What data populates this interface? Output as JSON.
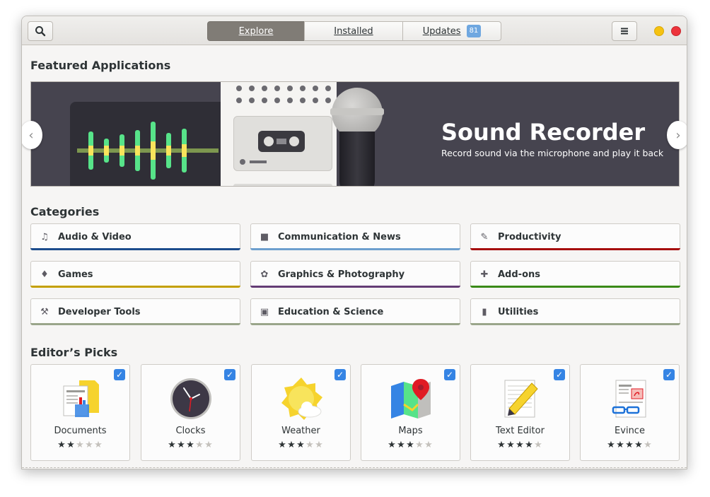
{
  "header": {
    "tabs": [
      {
        "label": "Explore",
        "active": true
      },
      {
        "label": "Installed",
        "active": false
      },
      {
        "label": "Updates",
        "active": false,
        "badge": "81"
      }
    ],
    "icons": {
      "search": "search-icon",
      "menu": "hamburger-menu-icon",
      "minimize": "minimize-icon",
      "close": "close-icon"
    }
  },
  "featured": {
    "section_title": "Featured Applications",
    "app_name": "Sound Recorder",
    "description": "Record sound via the microphone and play it back",
    "prev_arrow": "‹",
    "next_arrow": "›"
  },
  "categories": {
    "section_title": "Categories",
    "items": [
      {
        "label": "Audio & Video",
        "icon": "♫",
        "color": "#1c4c8c"
      },
      {
        "label": "Communication & News",
        "icon": "■",
        "color": "#6d9fce"
      },
      {
        "label": "Productivity",
        "icon": "✎",
        "color": "#a50d0d"
      },
      {
        "label": "Games",
        "icon": "♦",
        "color": "#c4a000"
      },
      {
        "label": "Graphics & Photography",
        "icon": "✿",
        "color": "#643c75"
      },
      {
        "label": "Add-ons",
        "icon": "✚",
        "color": "#3a8a18"
      },
      {
        "label": "Developer Tools",
        "icon": "⚒",
        "color": "#9aa58a"
      },
      {
        "label": "Education & Science",
        "icon": "▣",
        "color": "#9aa58a"
      },
      {
        "label": "Utilities",
        "icon": "▮",
        "color": "#9aa58a"
      }
    ]
  },
  "picks": {
    "section_title": "Editor’s Picks",
    "checkmark": "✓",
    "star_glyph": "★",
    "apps": [
      {
        "name": "Documents",
        "rating": 2
      },
      {
        "name": "Clocks",
        "rating": 3
      },
      {
        "name": "Weather",
        "rating": 3
      },
      {
        "name": "Maps",
        "rating": 3
      },
      {
        "name": "Text Editor",
        "rating": 4
      },
      {
        "name": "Evince",
        "rating": 4
      }
    ]
  }
}
